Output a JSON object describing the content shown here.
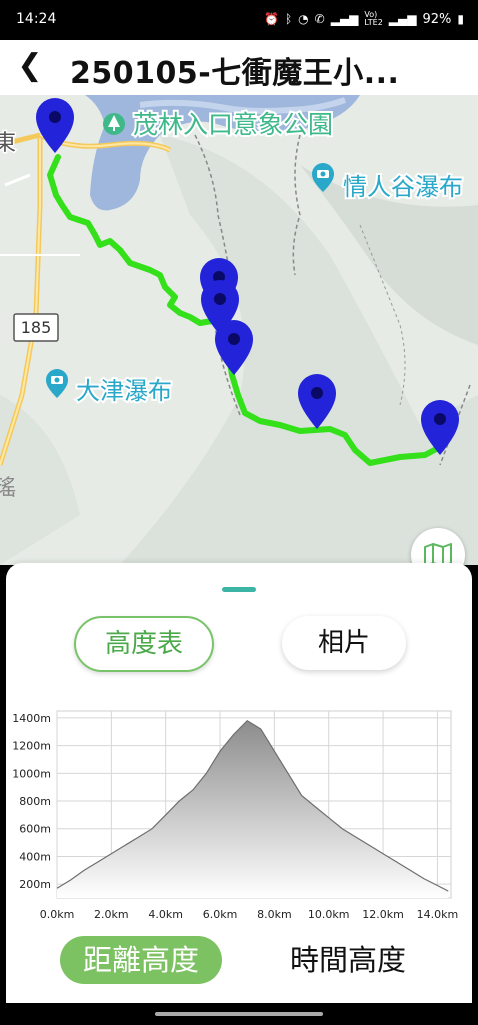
{
  "status_bar": {
    "time": "14:24",
    "icons": [
      "alarm-icon",
      "bluetooth-icon",
      "wifi-icon",
      "call-icon",
      "signal-icon",
      "volte-icon",
      "signal-icon"
    ],
    "battery": "92%"
  },
  "header": {
    "back_icon": "back-arrow-icon",
    "title": "250105-七衝魔王小..."
  },
  "map": {
    "road_label": "185",
    "pois": [
      {
        "name": "茂林入口意象公園",
        "icon": "park-icon"
      },
      {
        "name": "情人谷瀑布",
        "icon": "camera-icon"
      },
      {
        "name": "大津瀑布",
        "icon": "camera-icon"
      }
    ],
    "edge_labels": [
      "東",
      "瑤"
    ],
    "route_color": "#33e01a",
    "marker_color": "#2323d9",
    "layers_icon": "map-layers-icon"
  },
  "tabs": {
    "elevation_label": "高度表",
    "photos_label": "相片"
  },
  "chart_data": {
    "type": "area",
    "x": [
      0.0,
      0.5,
      1.0,
      1.5,
      2.0,
      2.5,
      3.0,
      3.5,
      4.0,
      4.5,
      5.0,
      5.5,
      6.0,
      6.5,
      7.0,
      7.5,
      8.0,
      8.5,
      9.0,
      9.5,
      10.0,
      10.5,
      11.0,
      11.5,
      12.0,
      12.5,
      13.0,
      13.5,
      14.0,
      14.4
    ],
    "y": [
      170,
      230,
      300,
      360,
      420,
      480,
      540,
      600,
      700,
      800,
      880,
      1000,
      1160,
      1280,
      1380,
      1320,
      1160,
      1000,
      840,
      760,
      680,
      600,
      540,
      480,
      420,
      360,
      300,
      240,
      190,
      150
    ],
    "xlim": [
      0,
      14.5
    ],
    "ylim": [
      100,
      1450
    ],
    "x_ticks": [
      0,
      2,
      4,
      6,
      8,
      10,
      12,
      14
    ],
    "x_tick_labels": [
      "0.0km",
      "2.0km",
      "4.0km",
      "6.0km",
      "8.0km",
      "10.0km",
      "12.0km",
      "14.0km"
    ],
    "y_ticks": [
      200,
      400,
      600,
      800,
      1000,
      1200,
      1400
    ],
    "y_tick_labels": [
      "200m",
      "400m",
      "600m",
      "800m",
      "1000m",
      "1200m",
      "1400m"
    ],
    "grid": true,
    "fill_colors": [
      "#8c8c8c",
      "#ffffff"
    ]
  },
  "mode_buttons": {
    "distance_label": "距離高度",
    "time_label": "時間高度"
  }
}
